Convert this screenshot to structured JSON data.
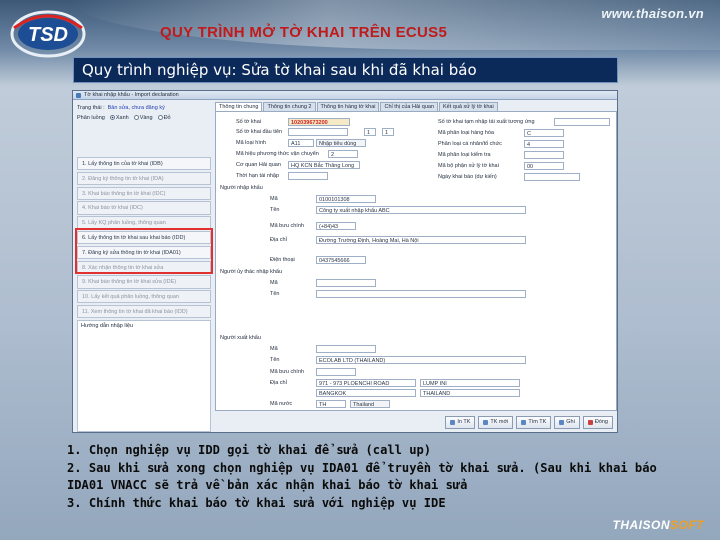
{
  "slide": {
    "site_url": "www.thaison.vn",
    "logo_text": "TSD",
    "title": "QUY TRÌNH MỞ TỜ KHAI TRÊN ECUS5",
    "banner": "Quy trình nghiệp vụ: Sửa tờ khai sau khi đã khai báo",
    "brand_a": "THAISON",
    "brand_b": "SOFT"
  },
  "notes": [
    "1. Chọn nghiệp vụ IDD gọi tờ khai để sửa (call up)",
    "2. Sau khi sửa xong chọn nghiệp vụ IDA01 để truyền tờ khai sửa. (Sau khi khai báo",
    "IDA01 VNACC sẽ trả về bản xác nhận khai báo tờ khai sửa",
    "3. Chính thức khai báo tờ khai sửa với nghiệp vụ IDE"
  ],
  "app": {
    "title": "Tờ khai nhập khẩu - Import declaration",
    "status_label": "Trạng thái :",
    "status_value": "Bản sửa, chưa đăng ký",
    "kind_label": "Phân luồng",
    "kinds": [
      "Xanh",
      "Vàng",
      "Đỏ"
    ],
    "steps": [
      {
        "label": "1. Lấy thông tin của tờ khai (IDB)",
        "dim": false
      },
      {
        "label": "2. Đăng ký thông tin tờ khai (IDA)",
        "dim": true
      },
      {
        "label": "3. Khai báo thông tin tờ khai (IDC)",
        "dim": true
      },
      {
        "label": "4. Khai báo tờ khai (IDC)",
        "dim": true
      },
      {
        "label": "5. Lấy KQ phân luồng, thông quan",
        "dim": true
      },
      {
        "label": "6. Lấy thông tin tờ khai sau khai báo (IDD)",
        "dim": false
      },
      {
        "label": "7. Đăng ký sửa thông tin tờ khai (IDA01)",
        "dim": false
      },
      {
        "label": "8. Xác nhận thông tin tờ khai sửa",
        "dim": true
      },
      {
        "label": "9. Khai báo thông tin tờ khai sửa (IDE)",
        "dim": true
      },
      {
        "label": "10. Lấy kết quả phân luồng, thông quan",
        "dim": true
      },
      {
        "label": "11. Xem thông tin tờ khai đã khai báo (IDD)",
        "dim": true
      }
    ],
    "guide_label": "Hướng dẫn nhập liệu",
    "tabs": [
      "Thông tin chung",
      "Thông tin chung 2",
      "Thông tin hàng tờ khai",
      "Chỉ thị của Hải quan",
      "Kết quả xử lý tờ khai"
    ],
    "form": {
      "so_to_khai_label": "Số tờ khai",
      "so_to_khai_value": "102039673200",
      "so_tk_dau_label": "Số tờ khai đầu tiên",
      "nhanh_value": "1",
      "nhanh_total": "1",
      "ma_loai_hinh_label": "Mã loại hình",
      "ma_loai_hinh_value": "A11",
      "ma_loai_hinh_desc": "Nhập tiêu dùng",
      "ma_phuong_thuc_label": "Mã hiệu phương thức vận chuyển",
      "ma_phuong_thuc_value": "2",
      "co_quan_hq_label": "Cơ quan Hải quan",
      "co_quan_hq_value": "HQ KCN Bắc Thăng Long",
      "ngay_khai_label": "Ngày khai báo (dự kiến)",
      "thoi_han_label": "Thời hạn tái nhập",
      "so_tk_tntx_label": "Số tờ khai tạm nhập tái xuất tương ứng",
      "ma_phan_loai_label": "Mã phân loại kiểm tra",
      "ma_phan_loai_value": "C",
      "ma_phan_loai_hang_label": "Mã phân loại hàng hóa",
      "phan_loai_ca_nhan_label": "Phân loại cá nhân/tổ chức",
      "phan_loai_ca_nhan_value": "4",
      "ma_bo_phan_label": "Mã bộ phận xử lý tờ khai",
      "ma_bo_phan_value": "00",
      "nguoi_nhap_khau": "Người nhập khẩu",
      "ma_label": "Mã",
      "ma_value": "0100101308",
      "ten_label": "Tên",
      "ten_value": "Công ty xuất nhập khẩu ABC",
      "buu_chinh_label": "Mã bưu chính",
      "buu_chinh_value": "(+84)43",
      "dia_chi_label": "Địa chỉ",
      "dia_chi_value": "Đường Trường Định, Hoàng Mai, Hà Nội",
      "dien_thoai_label": "Điện thoại",
      "dien_thoai_value": "0437545666",
      "nguoi_uy_thac": "Người ủy thác nhập khẩu",
      "nguoi_xuat_khau": "Người xuất khẩu",
      "xk_ten_value": "ECOLAB LTD (THAILAND)",
      "xk_diachi1": "971 - 973 PLOENCHI ROAD",
      "xk_diachi2": "LUMP INI",
      "xk_diachi3": "BANGKOK",
      "xk_diachi4": "THAILAND",
      "ma_nuoc_label": "Mã nước",
      "ma_nuoc_value": "TH",
      "ma_nuoc_desc": "Thailand"
    },
    "buttons": [
      "In TK",
      "TK mới",
      "Tìm TK",
      "Ghi",
      "Đóng"
    ]
  }
}
